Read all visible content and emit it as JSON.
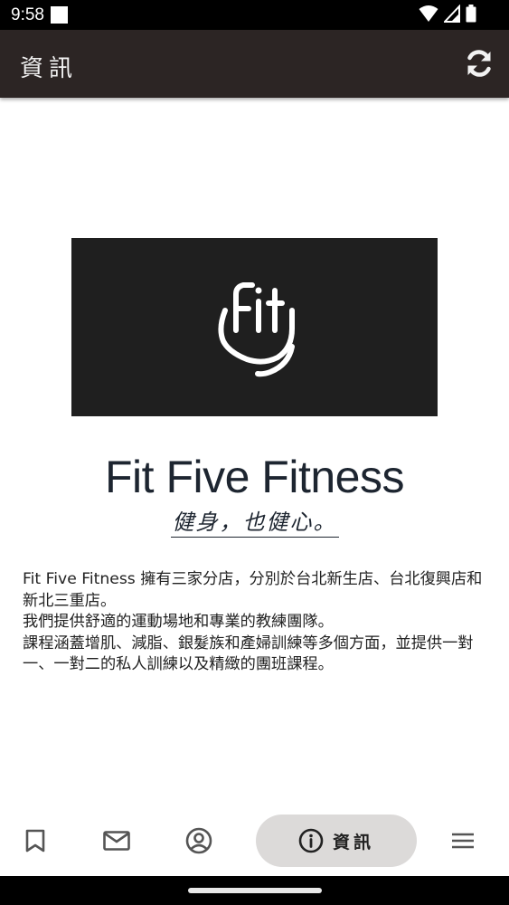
{
  "status_bar": {
    "time": "9:58",
    "icons": [
      "notification-square-icon",
      "wifi-icon",
      "cellular-signal-icon",
      "battery-icon"
    ]
  },
  "app_bar": {
    "title": "資訊",
    "refresh_icon": "refresh-icon",
    "background": "#2c2524"
  },
  "brand": {
    "logo_text": "Fit",
    "name": "Fit Five Fitness",
    "tagline": "健身，也健心。"
  },
  "description": {
    "lines": [
      "Fit Five Fitness 擁有三家分店，分別於台北新生店、台北復興店和新北三重店。",
      "我們提供舒適的運動場地和專業的教練團隊。",
      "課程涵蓋增肌、減脂、銀髮族和產婦訓練等多個方面，並提供一對一、一對二的私人訓練以及精緻的團班課程。"
    ]
  },
  "bottom_nav": {
    "items": [
      {
        "icon": "bookmark-icon",
        "label": ""
      },
      {
        "icon": "mail-icon",
        "label": ""
      },
      {
        "icon": "account-circle-icon",
        "label": ""
      },
      {
        "icon": "info-icon",
        "label": "資訊",
        "selected": true
      },
      {
        "icon": "menu-icon",
        "label": ""
      }
    ],
    "selected_background": "#dcdad9"
  }
}
